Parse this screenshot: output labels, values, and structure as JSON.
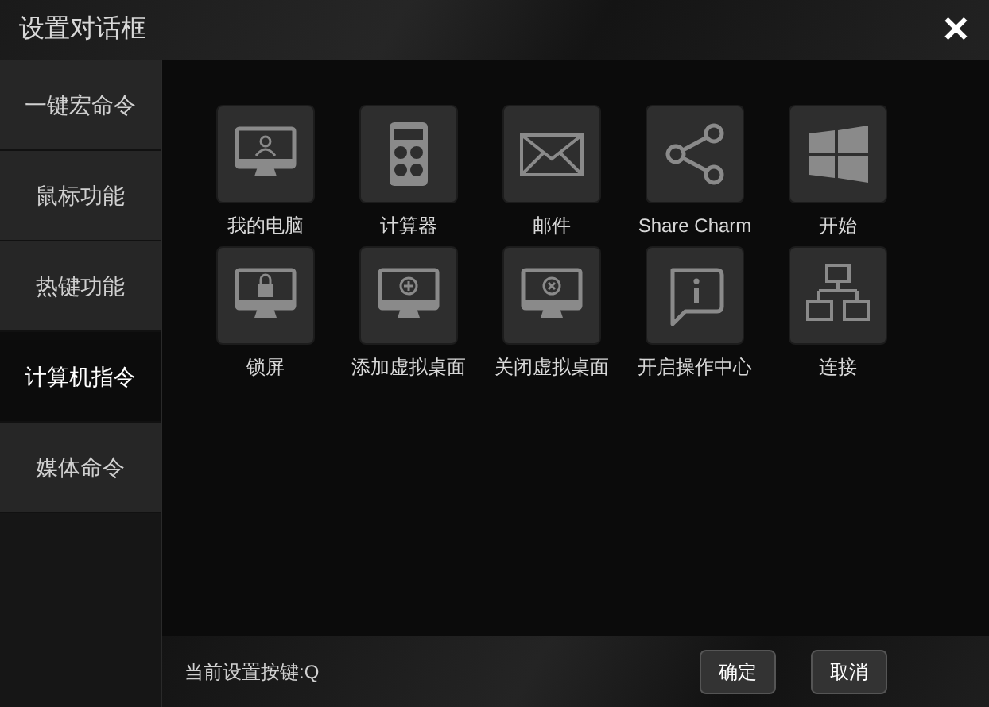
{
  "window": {
    "title": "设置对话框",
    "close": "✕"
  },
  "sidebar": {
    "items": [
      {
        "label": "一键宏命令",
        "selected": false
      },
      {
        "label": "鼠标功能",
        "selected": false
      },
      {
        "label": "热键功能",
        "selected": false
      },
      {
        "label": "计算机指令",
        "selected": true
      },
      {
        "label": "媒体命令",
        "selected": false
      }
    ]
  },
  "commands": [
    {
      "label": "我的电脑"
    },
    {
      "label": "计算器"
    },
    {
      "label": "邮件"
    },
    {
      "label": "Share Charm"
    },
    {
      "label": "开始"
    },
    {
      "label": "锁屏"
    },
    {
      "label": "添加虚拟桌面"
    },
    {
      "label": "关闭虚拟桌面"
    },
    {
      "label": "开启操作中心"
    },
    {
      "label": "连接"
    }
  ],
  "footer": {
    "status": "当前设置按键:Q",
    "buttons": [
      "确定",
      "取消"
    ]
  }
}
